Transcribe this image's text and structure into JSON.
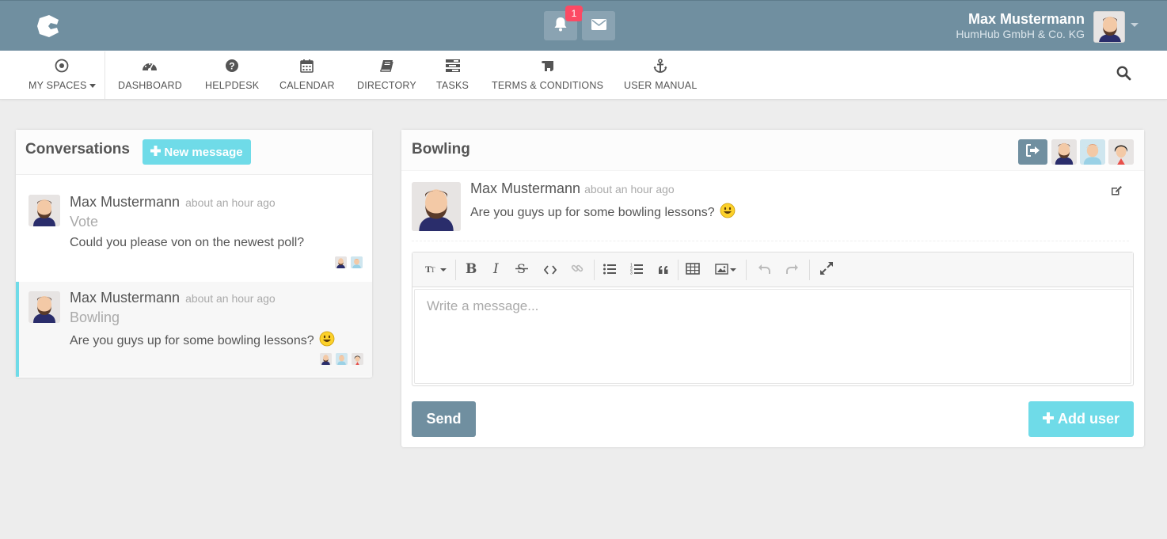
{
  "topbar": {
    "notification_count": "1",
    "user_name": "Max Mustermann",
    "user_company": "HumHub GmbH & Co. KG"
  },
  "nav": {
    "items": [
      {
        "label": "MY SPACES",
        "icon": "target-icon"
      },
      {
        "label": "DASHBOARD",
        "icon": "dashboard-icon"
      },
      {
        "label": "HELPDESK",
        "icon": "question-circle-icon"
      },
      {
        "label": "CALENDAR",
        "icon": "calendar-icon"
      },
      {
        "label": "DIRECTORY",
        "icon": "book-icon"
      },
      {
        "label": "TASKS",
        "icon": "tasks-icon"
      },
      {
        "label": "TERMS & CONDITIONS",
        "icon": "scroll-icon"
      },
      {
        "label": "USER MANUAL",
        "icon": "anchor-icon"
      }
    ]
  },
  "conversations": {
    "title": "Conversations",
    "new_message_label": "New message",
    "items": [
      {
        "author": "Max Mustermann",
        "time": "about an hour ago",
        "subject": "Vote",
        "preview": "Could you please von on the newest poll?"
      },
      {
        "author": "Max Mustermann",
        "time": "about an hour ago",
        "subject": "Bowling",
        "preview": "Are you guys up for some bowling lessons?"
      }
    ]
  },
  "chat": {
    "title": "Bowling",
    "message": {
      "author": "Max Mustermann",
      "time": "about an hour ago",
      "text": "Are you guys up for some bowling lessons?"
    },
    "editor_placeholder": "Write a message...",
    "send_label": "Send",
    "add_user_label": "Add user"
  },
  "colors": {
    "topbar": "#708fa0",
    "accent": "#6fdbe8",
    "badge": "#fc4a64"
  }
}
